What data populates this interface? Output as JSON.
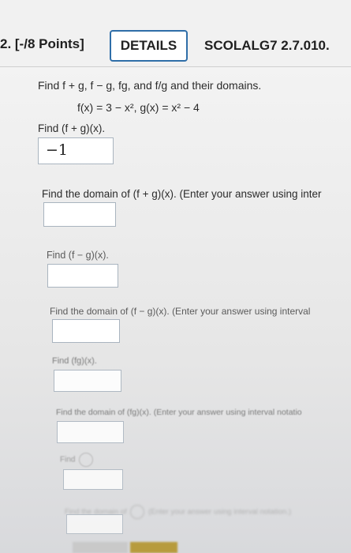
{
  "header": {
    "question_number": "2.  [-/8 Points]",
    "details_label": "DETAILS",
    "code": "SCOLALG7 2.7.010."
  },
  "problem": {
    "instruction": "Find f + g,  f − g,  fg,  and f/g and their domains.",
    "functions": "f(x) = 3 − x²,    g(x) = x² − 4"
  },
  "parts": {
    "p1_label": "Find  (f + g)(x).",
    "p1_answer": "−1",
    "p2_label": "Find the domain of  (f + g)(x).  (Enter your answer using inter",
    "p3_label": "Find  (f − g)(x).",
    "p4_label": "Find the domain of  (f − g)(x).  (Enter your answer using interval",
    "p5_label": "Find  (fg)(x).",
    "p6_label": "Find the domain of  (fg)(x).  (Enter your answer using interval notatio",
    "p7_label": "Find",
    "p8_label": "Find the domain of",
    "p8_suffix": "(Enter your answer using interval notation.)"
  },
  "colors": {
    "details_border": "#2f6ea8",
    "accent_red": "#c0392b"
  }
}
